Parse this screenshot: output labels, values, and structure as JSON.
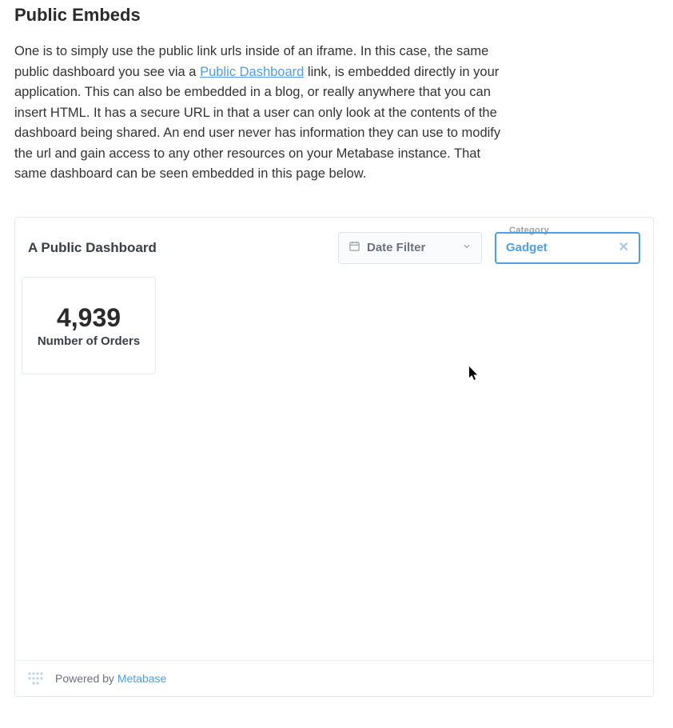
{
  "page": {
    "title": "Public Embeds",
    "intro_before": "One is to simply use the public link urls inside of an iframe. In this case, the same public dashboard you see via a ",
    "intro_link": "Public Dashboard",
    "intro_after": " link, is embedded directly in your application. This can also be embedded in a blog, or really anywhere that you can insert HTML. It has a secure URL in that a user can only look at the contents of the dashboard being shared. An end user never has information they can use to modify the url and gain access to any other resources on your Metabase instance. That same dashboard can be seen embedded in this page below."
  },
  "dashboard": {
    "title": "A Public Dashboard",
    "date_filter_label": "Date Filter",
    "category_label": "Category",
    "category_value": "Gadget",
    "card_value": "4,939",
    "card_label": "Number of Orders",
    "footer_prefix": "Powered by ",
    "footer_brand": "Metabase"
  }
}
